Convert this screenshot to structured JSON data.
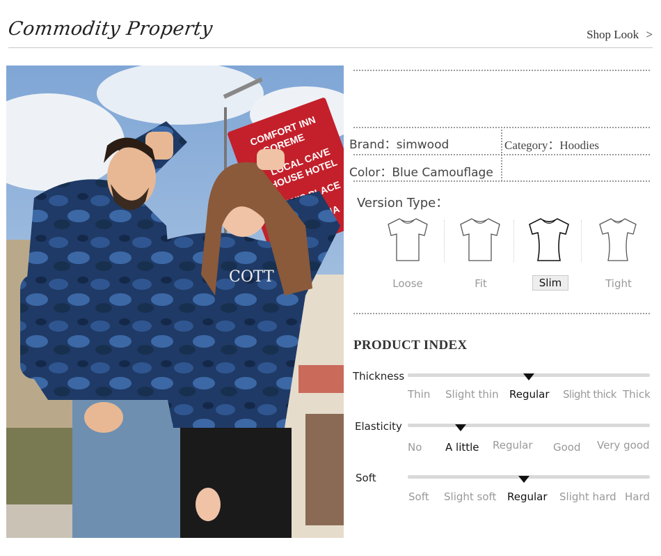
{
  "header": {
    "title": "Commodity Property",
    "shop_look": "Shop Look",
    "shop_look_arrow": ">"
  },
  "product": {
    "brand_label": "Brand：",
    "brand": "simwood",
    "category_label": "Category：",
    "category": "Hoodies",
    "color_label": "Color：",
    "color": "Blue Camouflage"
  },
  "version_type": {
    "title": "Version Type：",
    "options": [
      {
        "label": "Loose",
        "selected": false
      },
      {
        "label": "Fit",
        "selected": false
      },
      {
        "label": "Slim",
        "selected": true
      },
      {
        "label": "Tight",
        "selected": false
      }
    ]
  },
  "photo": {
    "sign_lines": [
      "COMFORT INN",
      "GOREME",
      "LOCAL CAVE",
      "HOUSE HOTEL",
      "CAN'S PLACE",
      "PANORAMA"
    ]
  },
  "product_index": {
    "title": "PRODUCT INDEX",
    "rows": [
      {
        "label": "Thickness",
        "options": [
          "Thin",
          "Slight thin",
          "Regular",
          "Slight thick",
          "Thick"
        ],
        "selected": 2
      },
      {
        "label": "Elasticity",
        "options": [
          "No",
          "A little",
          "Regular",
          "Good",
          "Very good"
        ],
        "selected": 1
      },
      {
        "label": "Soft",
        "options": [
          "Soft",
          "Slight soft",
          "Regular",
          "Slight hard",
          "Hard"
        ],
        "selected": 2
      }
    ]
  },
  "colors": {
    "accent_marker": "#111111",
    "track": "#d9d9d9",
    "hoodie": "#1f3a66"
  }
}
